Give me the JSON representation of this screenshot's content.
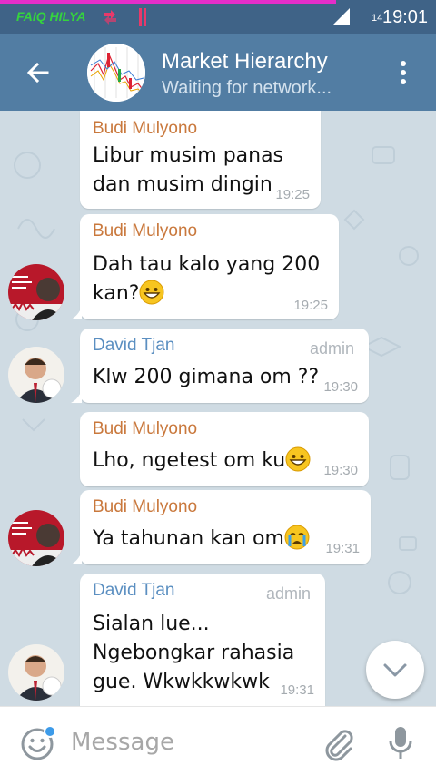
{
  "status_bar": {
    "carrier": "FAIQ HILYA",
    "network": "14",
    "time": "19:01"
  },
  "header": {
    "title": "Market Hierarchy",
    "subtitle": "Waiting for network..."
  },
  "messages": [
    {
      "sender": "Budi Mulyono",
      "lines": [
        "Libur musim panas",
        "dan musim dingin"
      ],
      "time": "19:25"
    },
    {
      "sender": "Budi Mulyono",
      "lines": [
        "Dah tau kalo yang 200",
        "kan?"
      ],
      "emoji": "grinning-face",
      "time": "19:25"
    },
    {
      "sender": "David Tjan",
      "role": "admin",
      "lines": [
        "Klw 200 gimana om ??"
      ],
      "time": "19:30"
    },
    {
      "sender": "Budi Mulyono",
      "lines": [
        "Lho, ngetest om ku"
      ],
      "emoji": "grinning-face",
      "time": "19:30"
    },
    {
      "sender": "Budi Mulyono",
      "lines": [
        "Ya tahunan kan om"
      ],
      "emoji": "crying-face",
      "time": "19:31"
    },
    {
      "sender": "David Tjan",
      "role": "admin",
      "lines": [
        "Sialan lue...",
        "Ngebongkar rahasia",
        "gue. Wkwkkwkwk"
      ],
      "time": "19:31"
    }
  ],
  "input": {
    "placeholder": "Message"
  },
  "colors": {
    "header": "#527da3",
    "status_bar": "#3f6387",
    "budi_name": "#c9783c",
    "david_name": "#5b8fc1",
    "chat_bg": "#cfdbe3"
  }
}
